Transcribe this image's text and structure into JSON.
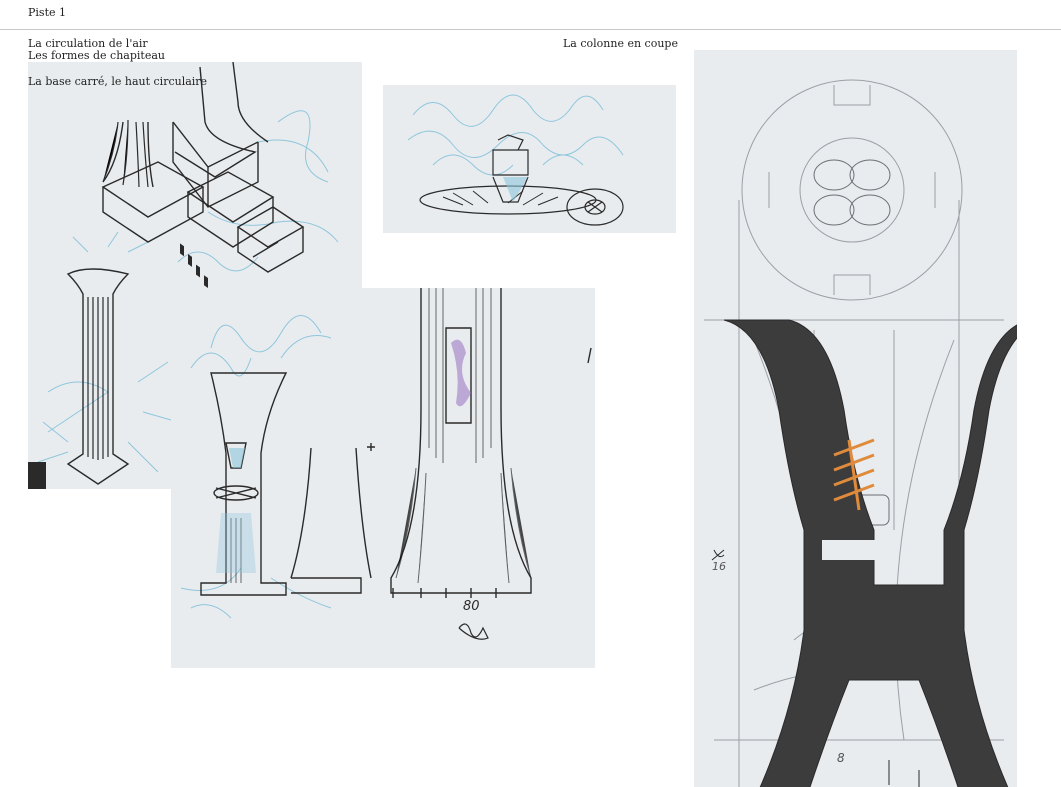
{
  "page": {
    "title": "Piste 1"
  },
  "captions": {
    "air": "La circulation de l'air",
    "capitals": "Les formes de chapiteau",
    "base": "La base carré, le haut circulaire",
    "section": "La colonne en coupe"
  },
  "sketch_notes": {
    "dimension_height": "80",
    "dimension_width": "8",
    "dimension_side": "16"
  },
  "colors": {
    "paper": "#e9ecef",
    "graphite": "#2a2a2a",
    "pencil_light": "#9aa0a6",
    "air_blue": "#8ec6dc",
    "accent_orange": "#e08a3c",
    "accent_violet": "#a78bc9"
  }
}
